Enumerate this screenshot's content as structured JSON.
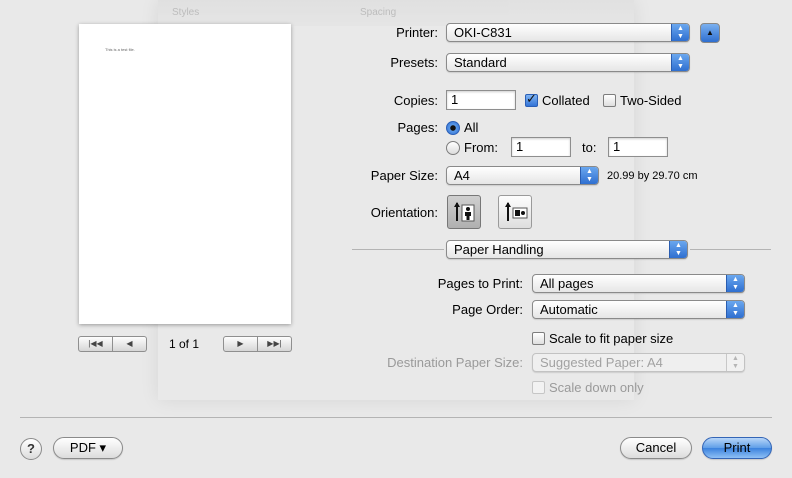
{
  "background_toolbar": {
    "styles_label": "Styles",
    "spacing_label": "Spacing"
  },
  "preview": {
    "page_text": "This is a test file.",
    "page_count": "1 of 1",
    "nav_first_icon": "first-page-icon",
    "nav_prev_icon": "previous-page-icon",
    "nav_next_icon": "next-page-icon",
    "nav_last_icon": "last-page-icon"
  },
  "printer": {
    "label": "Printer:",
    "value": "OKI-C831",
    "disclosure_icon": "disclosure-triangle-up-icon"
  },
  "presets": {
    "label": "Presets:",
    "value": "Standard"
  },
  "copies": {
    "label": "Copies:",
    "value": "1",
    "collated_label": "Collated",
    "collated_checked": true,
    "two_sided_label": "Two-Sided",
    "two_sided_checked": false
  },
  "pages": {
    "label": "Pages:",
    "all_label": "All",
    "all_selected": true,
    "from_label": "From:",
    "from_value": "1",
    "to_label": "to:",
    "to_value": "1"
  },
  "paper_size": {
    "label": "Paper Size:",
    "value": "A4",
    "dimensions": "20.99 by 29.70 cm"
  },
  "orientation": {
    "label": "Orientation:",
    "portrait_icon": "portrait-orientation-icon",
    "landscape_icon": "landscape-orientation-icon",
    "selected": "portrait"
  },
  "section_popup": {
    "value": "Paper Handling"
  },
  "paper_handling": {
    "pages_to_print_label": "Pages to Print:",
    "pages_to_print_value": "All pages",
    "page_order_label": "Page Order:",
    "page_order_value": "Automatic",
    "scale_to_fit_label": "Scale to fit paper size",
    "scale_to_fit_checked": false,
    "destination_label": "Destination Paper Size:",
    "destination_value": "Suggested Paper: A4",
    "scale_down_label": "Scale down only",
    "scale_down_checked": false
  },
  "footer": {
    "help_label": "?",
    "pdf_label": "PDF ▾",
    "cancel_label": "Cancel",
    "print_label": "Print"
  },
  "colors": {
    "accent": "#3b82de",
    "dialog_bg": "#e9e9e9"
  }
}
